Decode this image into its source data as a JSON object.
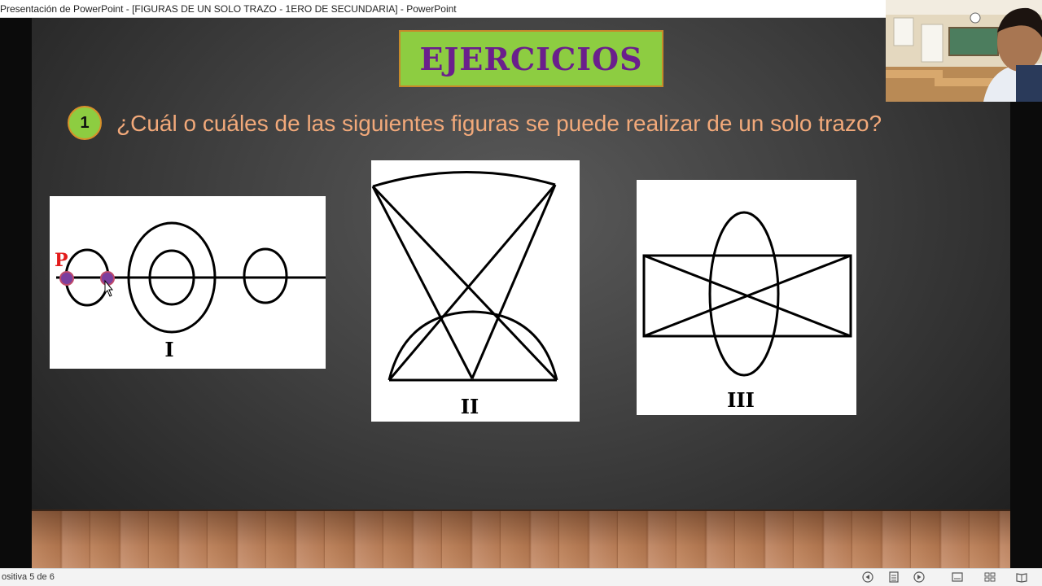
{
  "window": {
    "title": "Presentación de PowerPoint - [FIGURAS DE UN SOLO TRAZO - 1ERO DE SECUNDARIA] - PowerPoint"
  },
  "slide": {
    "heading": "EJERCICIOS",
    "question_number": "1",
    "question_text": "¿Cuál o cuáles de las siguientes figuras se puede realizar de un solo trazo?",
    "figures": [
      {
        "label": "I",
        "point_label": "P"
      },
      {
        "label": "II"
      },
      {
        "label": "III"
      }
    ]
  },
  "status_bar": {
    "slide_indicator": "ositiva 5 de 6",
    "icons": [
      "previous-icon",
      "notes-icon",
      "next-icon",
      "normal-view-icon",
      "slide-sorter-icon",
      "reading-view-icon"
    ]
  },
  "colors": {
    "heading_bg": "#8dcd41",
    "heading_text": "#6a1f8c",
    "question_text": "#f2a97a",
    "point_fill": "#7b3f9e",
    "point_label": "#e31b1b"
  }
}
